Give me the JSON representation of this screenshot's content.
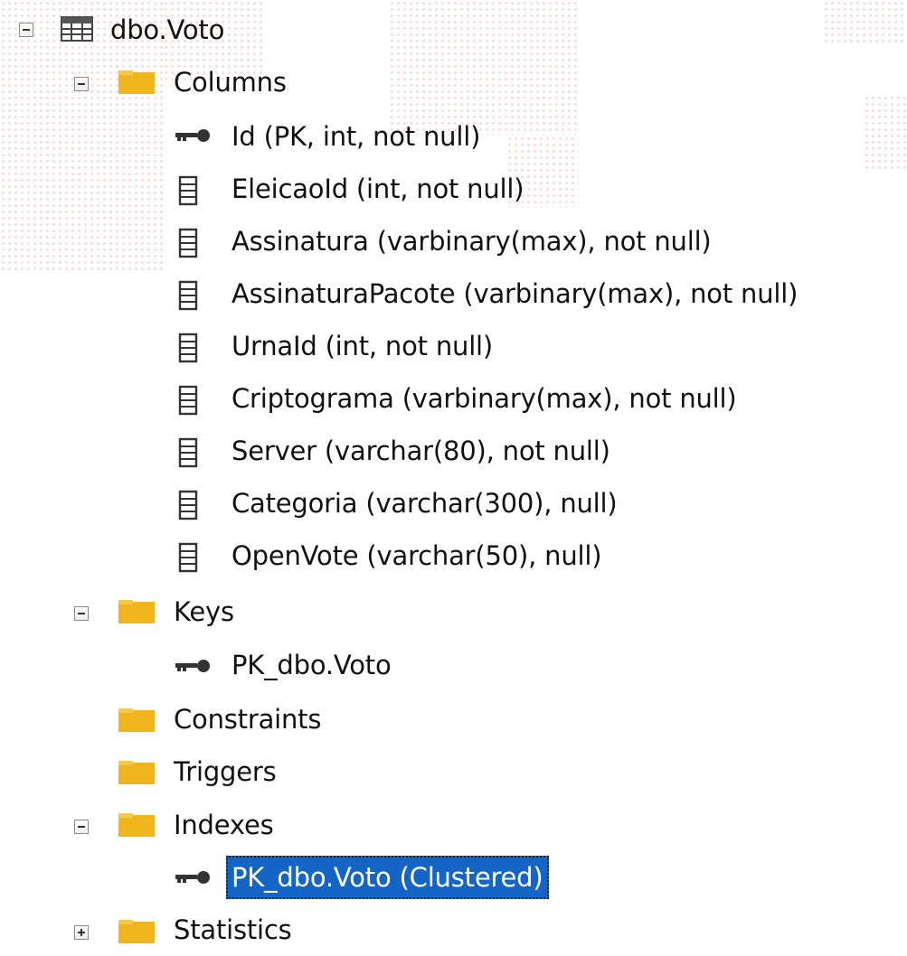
{
  "tree": {
    "table_label": "dbo.Voto",
    "columns_folder": "Columns",
    "columns": [
      {
        "label": "Id (PK, int, not null)",
        "icon": "key-icon"
      },
      {
        "label": "EleicaoId (int, not null)",
        "icon": "column-icon"
      },
      {
        "label": "Assinatura (varbinary(max), not null)",
        "icon": "column-icon"
      },
      {
        "label": "AssinaturaPacote (varbinary(max), not null)",
        "icon": "column-icon"
      },
      {
        "label": "UrnaId (int, not null)",
        "icon": "column-icon"
      },
      {
        "label": "Criptograma (varbinary(max), not null)",
        "icon": "column-icon"
      },
      {
        "label": "Server (varchar(80), not null)",
        "icon": "column-icon"
      },
      {
        "label": "Categoria (varchar(300), null)",
        "icon": "column-icon"
      },
      {
        "label": "OpenVote (varchar(50), null)",
        "icon": "column-icon"
      }
    ],
    "keys_folder": "Keys",
    "keys": [
      {
        "label": "PK_dbo.Voto",
        "icon": "key-icon"
      }
    ],
    "constraints_folder": "Constraints",
    "triggers_folder": "Triggers",
    "indexes_folder": "Indexes",
    "indexes": [
      {
        "label": "PK_dbo.Voto (Clustered)",
        "icon": "key-icon",
        "selected": true
      }
    ],
    "statistics_folder": "Statistics"
  },
  "colors": {
    "selection": "#1565c7",
    "folder": "#f0b41c",
    "text": "#111111"
  }
}
